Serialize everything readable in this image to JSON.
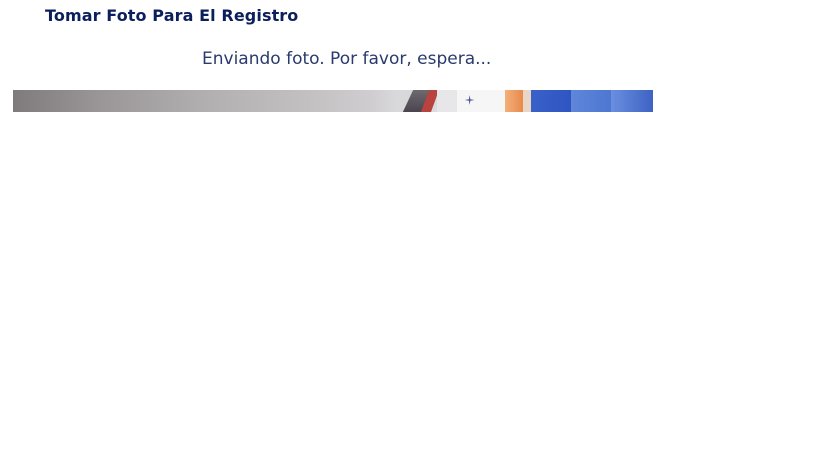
{
  "header": {
    "title": "Tomar Foto Para El Registro"
  },
  "status": {
    "message": "Enviando foto. Por favor, espera..."
  },
  "photo": {
    "description_icon": "camera-preview"
  }
}
